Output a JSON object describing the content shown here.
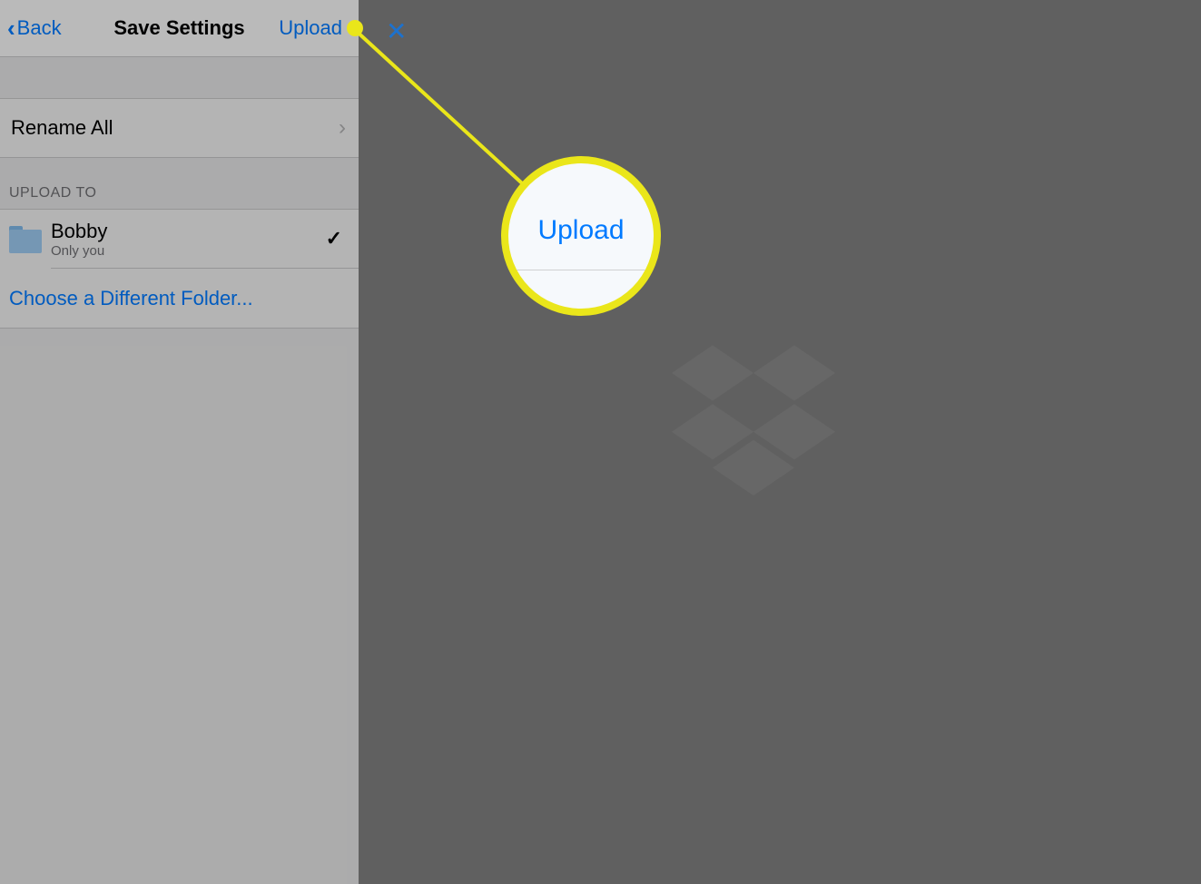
{
  "header": {
    "back": "Back",
    "title": "Save Settings",
    "upload": "Upload"
  },
  "rows": {
    "rename": "Rename All",
    "section_label": "UPLOAD TO",
    "folder_name": "Bobby",
    "folder_sub": "Only you",
    "choose": "Choose a Different Folder..."
  },
  "callout": {
    "label": "Upload"
  },
  "colors": {
    "accent": "#007AFF",
    "highlight": "#eae61a"
  }
}
